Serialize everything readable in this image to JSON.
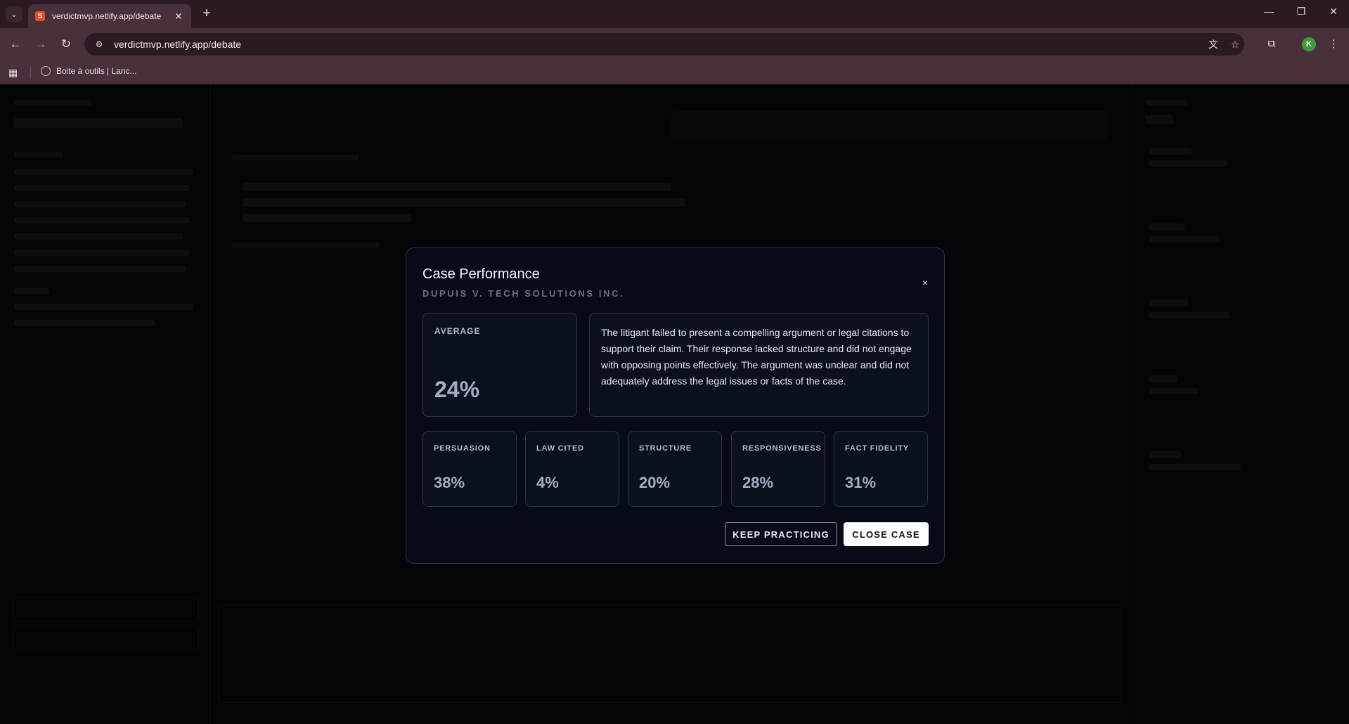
{
  "browser": {
    "tab_title": "verdictmvp.netlify.app/debate",
    "url": "verdictmvp.netlify.app/debate",
    "bookmark_label": "Boite à outils | Lanc...",
    "profile_initial": "K",
    "icons": {
      "tab_list": "chevron-down-icon",
      "favicon": "svelte-icon",
      "tab_close": "close-icon",
      "new_tab": "plus-icon",
      "back": "arrow-left-icon",
      "forward": "arrow-right-icon",
      "reload": "reload-icon",
      "site_info": "tune-icon",
      "translate": "translate-icon",
      "bookmark_star": "star-icon",
      "extensions": "puzzle-icon",
      "menu": "kebab-menu-icon",
      "apps": "apps-grid-icon",
      "globe": "globe-icon"
    },
    "glyphs": {
      "tab_list": "⌄",
      "favicon": "S",
      "tab_close": "✕",
      "new_tab": "+",
      "minimize": "—",
      "maximize": "❐",
      "window_close": "✕",
      "back": "←",
      "forward": "→",
      "reload": "↻",
      "site_info": "⚙",
      "translate": "文",
      "star": "☆",
      "extensions": "⧉",
      "menu": "⋮",
      "apps": "▦"
    }
  },
  "modal": {
    "title": "Case Performance",
    "subtitle": "DUPUIS V. TECH SOLUTIONS INC.",
    "close_glyph": "×",
    "average": {
      "label": "AVERAGE",
      "value": "24%"
    },
    "summary": "The litigant failed to present a compelling argument or legal citations to support their claim. Their response lacked structure and did not engage with opposing points effectively. The argument was unclear and did not adequately address the legal issues or facts of the case.",
    "metrics": [
      {
        "label": "PERSUASION",
        "value": "38%"
      },
      {
        "label": "LAW CITED",
        "value": "4%"
      },
      {
        "label": "STRUCTURE",
        "value": "20%"
      },
      {
        "label": "RESPONSIVENESS",
        "value": "28%"
      },
      {
        "label": "FACT FIDELITY",
        "value": "31%"
      }
    ],
    "buttons": {
      "keep_practicing": "KEEP PRACTICING",
      "close_case": "CLOSE CASE"
    }
  },
  "colors": {
    "modal_bg": "#070b17",
    "card_border": "#2a3344",
    "value_text": "#a3aec4",
    "chrome_bg": "#4a2f3d"
  }
}
